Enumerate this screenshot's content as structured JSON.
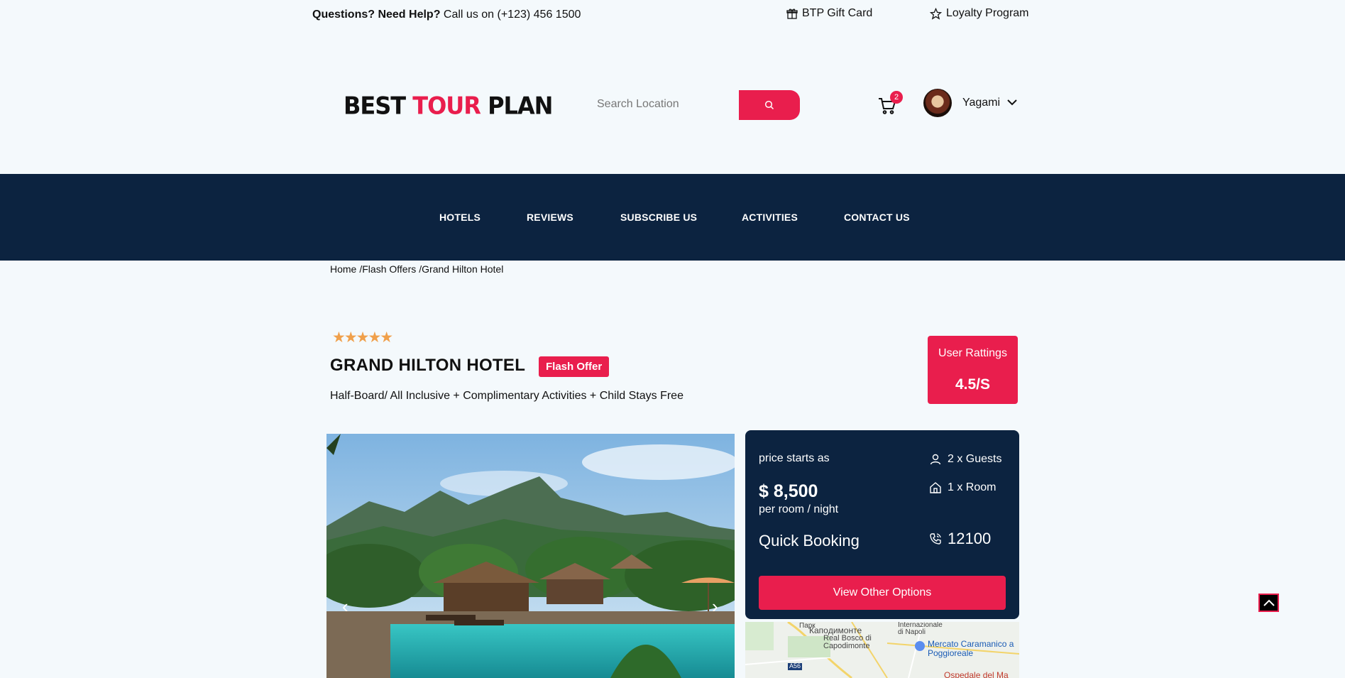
{
  "topbar": {
    "help_strong": "Questions? Need Help?",
    "help_text": " Call us on (+123) 456 1500",
    "gift_label": "BTP Gift Card",
    "loyalty_label": "Loyalty Program"
  },
  "header": {
    "logo_part1": "BEST ",
    "logo_part2": "TOUR",
    "logo_part3": " PLAN",
    "search_placeholder": "Search Location",
    "cart_count": "2",
    "username": "Yagami"
  },
  "nav": {
    "items": [
      "HOTELS",
      "REVIEWS",
      "SUBSCRIBE US",
      "ACTIVITIES",
      "CONTACT US"
    ]
  },
  "breadcrumb": [
    "Home",
    "/Flash Offers",
    "/Grand Hilton Hotel"
  ],
  "hotel": {
    "stars": "★★★★★",
    "name": "GRAND HILTON HOTEL",
    "badge": "Flash Offer",
    "subtitle": "Half-Board/ All Inclusive + Complimentary Activities + Child Stays Free"
  },
  "ratings": {
    "label": "User Rattings",
    "value": "4.5/S"
  },
  "booking": {
    "price_label": "price starts as",
    "price": "$ 8,500",
    "per": "per room / night",
    "quick": "Quick Booking",
    "guests": "2 x Guests",
    "room": "1 x Room",
    "phone": "12100",
    "options_button": "View Other Options"
  },
  "map": {
    "labels": [
      "Капoдимонте",
      "Real Bosco di Capodimonte",
      "Mercato Caramanico a Poggioreale",
      "Internazionale di Napoli",
      "Парк",
      "A56",
      "Ospedale del Ma"
    ]
  },
  "colors": {
    "accent": "#e91e4d",
    "navy": "#0c2340",
    "star": "#f0a04b",
    "background": "#f4f9fc"
  }
}
